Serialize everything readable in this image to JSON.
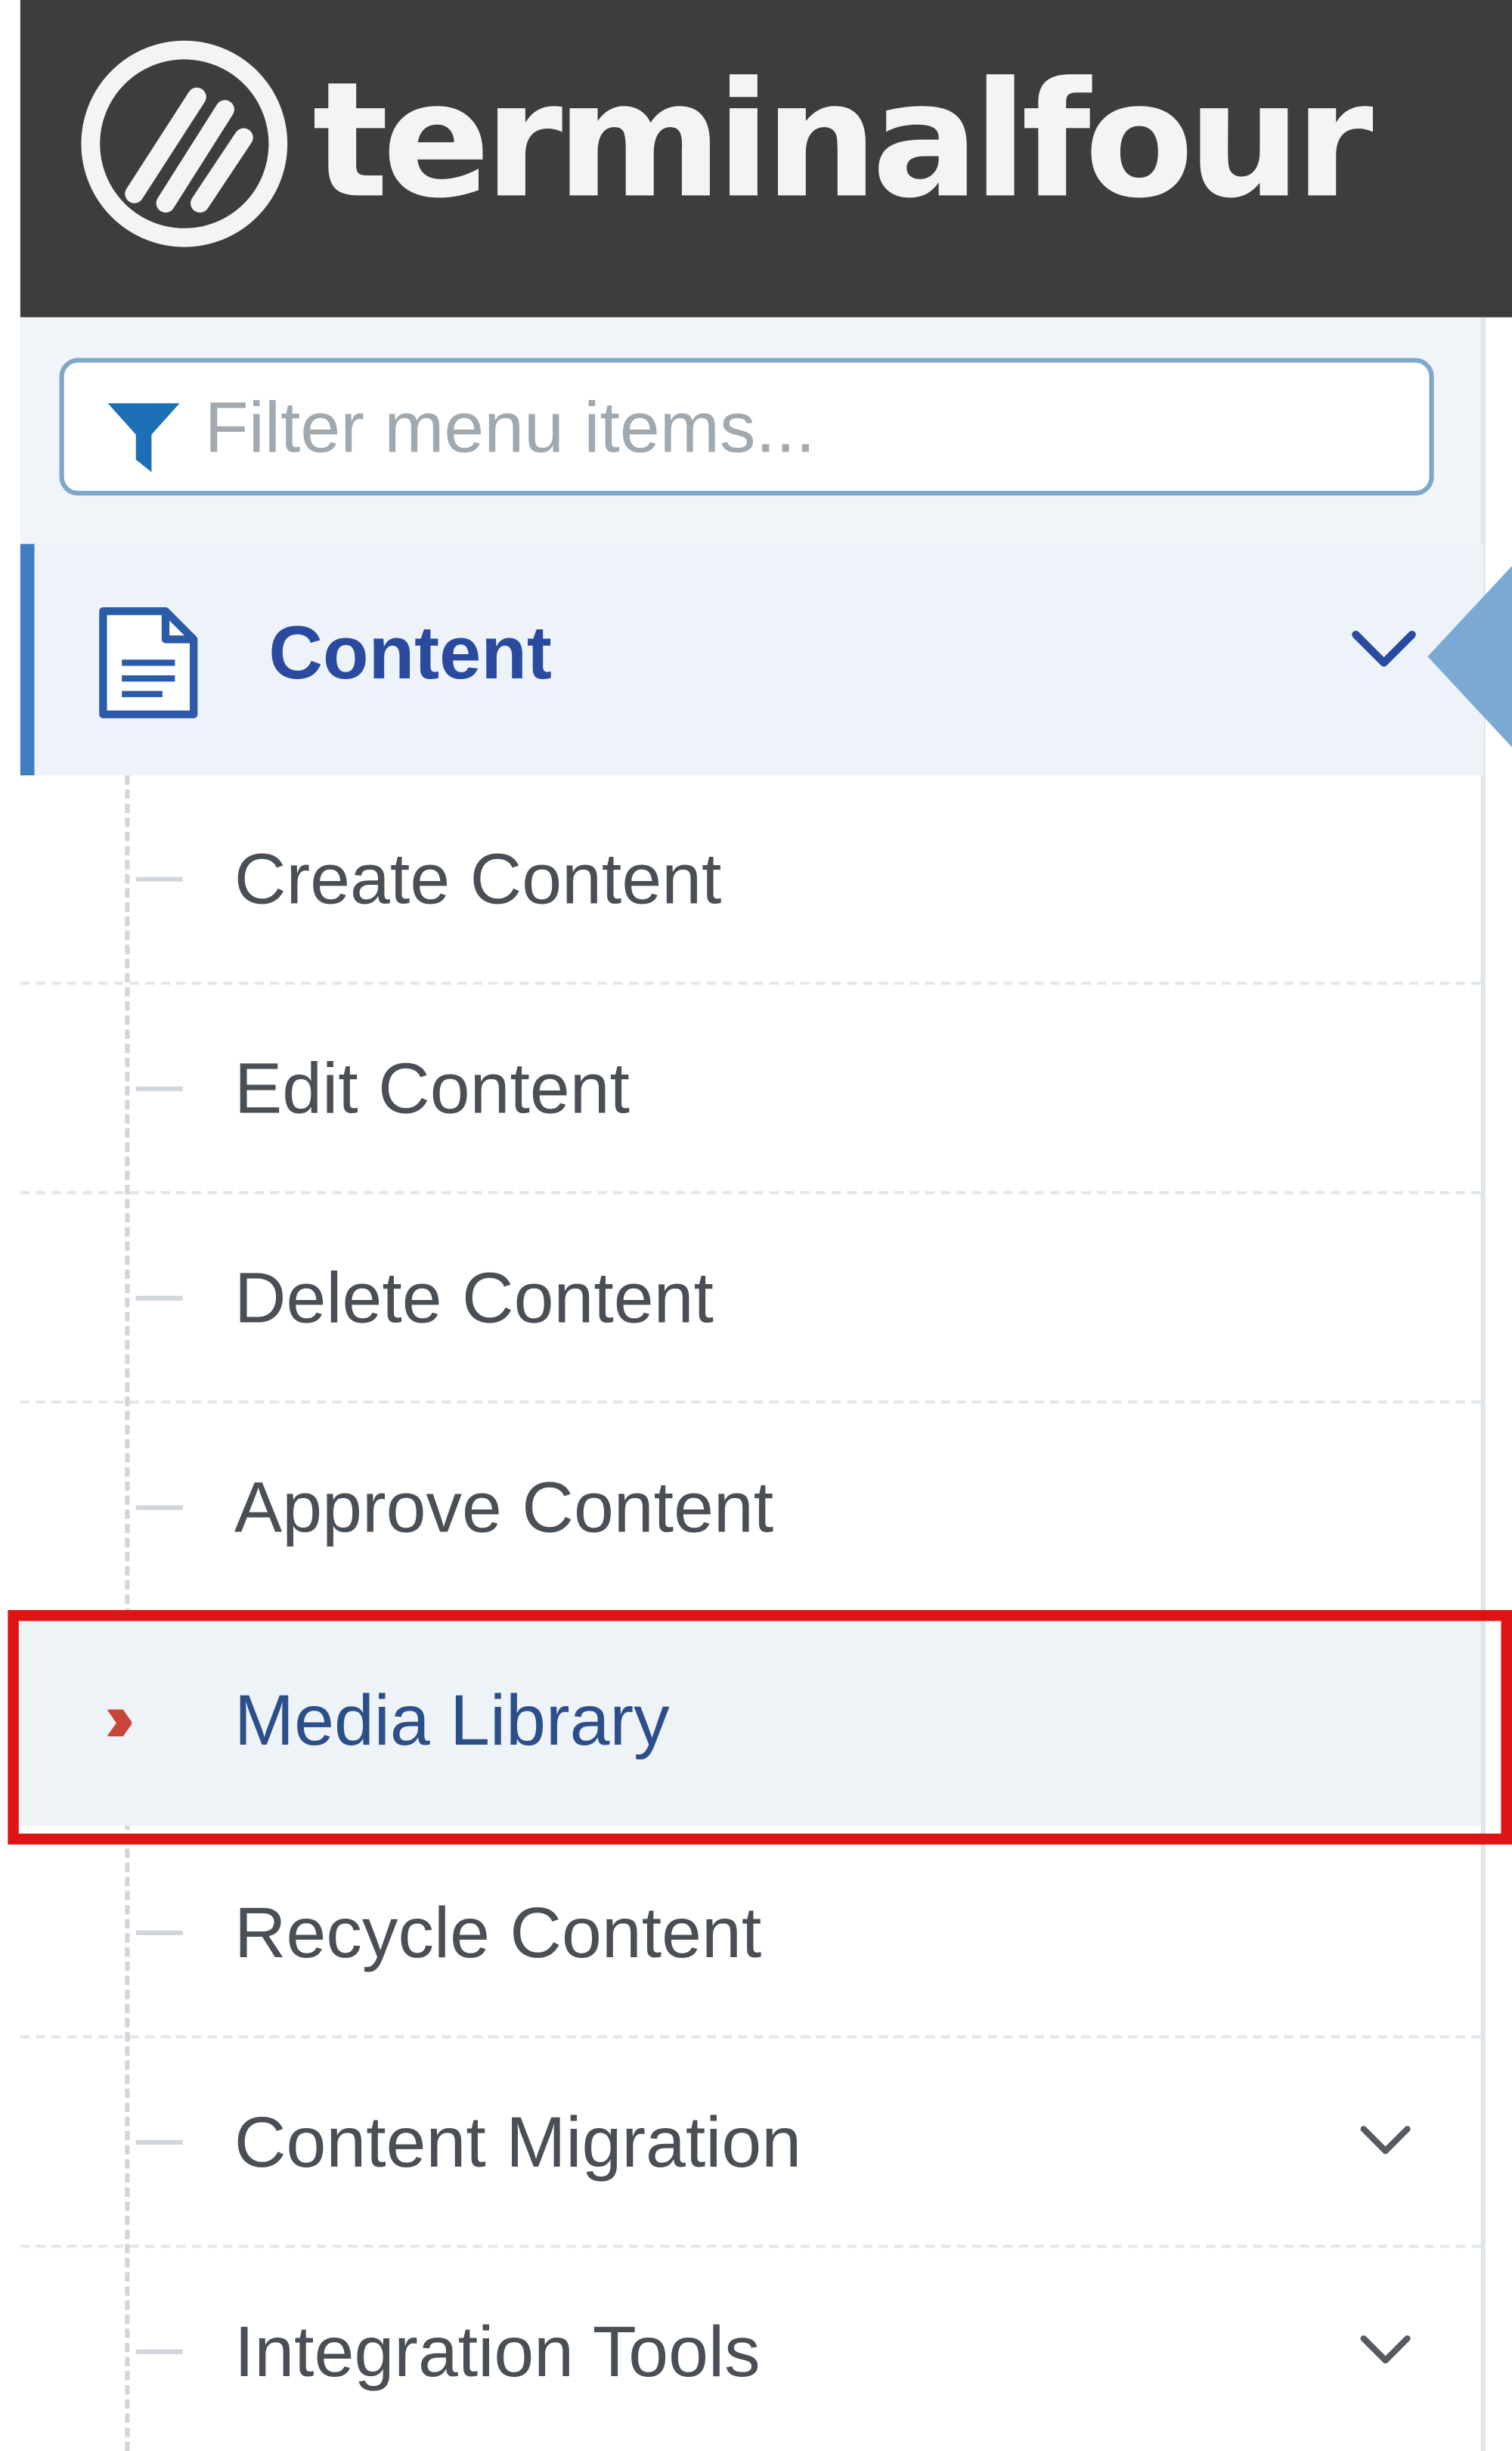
{
  "brand": {
    "name": "terminalfour"
  },
  "filter": {
    "placeholder": "Filter menu items..."
  },
  "nav": {
    "section": {
      "label": "Content",
      "expanded": true,
      "icon": "document-icon"
    },
    "items": [
      {
        "label": "Create Content",
        "selected": false,
        "has_children": false
      },
      {
        "label": "Edit Content",
        "selected": false,
        "has_children": false
      },
      {
        "label": "Delete Content",
        "selected": false,
        "has_children": false
      },
      {
        "label": "Approve Content",
        "selected": false,
        "has_children": false
      },
      {
        "label": "Media Library",
        "selected": true,
        "has_children": false
      },
      {
        "label": "Recycle Content",
        "selected": false,
        "has_children": false
      },
      {
        "label": "Content Migration",
        "selected": false,
        "has_children": true
      },
      {
        "label": "Integration Tools",
        "selected": false,
        "has_children": true
      }
    ]
  },
  "colors": {
    "header_bg": "#3d3d3d",
    "accent_blue": "#3e7dc0",
    "section_label": "#2a4aa0",
    "selected_marker": "#c8453a",
    "highlight_border": "#e01414"
  }
}
